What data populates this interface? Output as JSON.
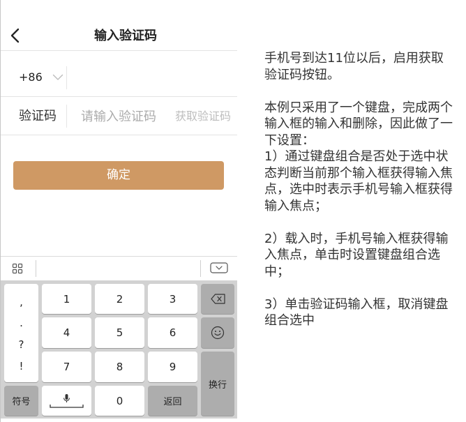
{
  "theme": {
    "accent": "#cf9964",
    "keyboard_bg": "#d2d2d2",
    "function_key": "#adadad"
  },
  "header": {
    "title": "输入验证码",
    "back_icon": "chevron-left-icon"
  },
  "phone_row": {
    "country_code": "+86",
    "dropdown_icon": "chevron-down-icon"
  },
  "code_row": {
    "label": "验证码",
    "placeholder": "请输入验证码",
    "get_code_label": "获取验证码"
  },
  "confirm_button": {
    "label": "确定"
  },
  "keyboard": {
    "toolbar": {
      "menu_icon": "grid-icon",
      "hide_icon": "keyboard-hide-icon"
    },
    "punctuation": [
      ",",
      ".",
      "?",
      "!"
    ],
    "symbols_label": "符号",
    "digits": [
      [
        "1",
        "2",
        "3"
      ],
      [
        "4",
        "5",
        "6"
      ],
      [
        "7",
        "8",
        "9"
      ]
    ],
    "space_icon": "microphone-icon",
    "zero": "0",
    "back_label": "返回",
    "delete_icon": "backspace-icon",
    "emoji_icon": "smiley-icon",
    "enter_label": "换行"
  },
  "notes": {
    "paragraphs": [
      [
        "手机号到达11位以后，启用获取",
        "验证码按钮。"
      ],
      [
        "本例只采用了一个键盘，完成两个",
        "输入框的输入和删除，因此做了一",
        "下设置：",
        "1）通过键盘组合是否处于选中状",
        "态判断当前那个输入框获得输入焦",
        "点，选中时表示手机号输入框获得",
        "输入焦点；"
      ],
      [
        "2）载入时，手机号输入框获得输",
        "入焦点，单击时设置键盘组合选",
        "中；"
      ],
      [
        "3）单击验证码输入框，取消键盘",
        "组合选中"
      ]
    ]
  }
}
